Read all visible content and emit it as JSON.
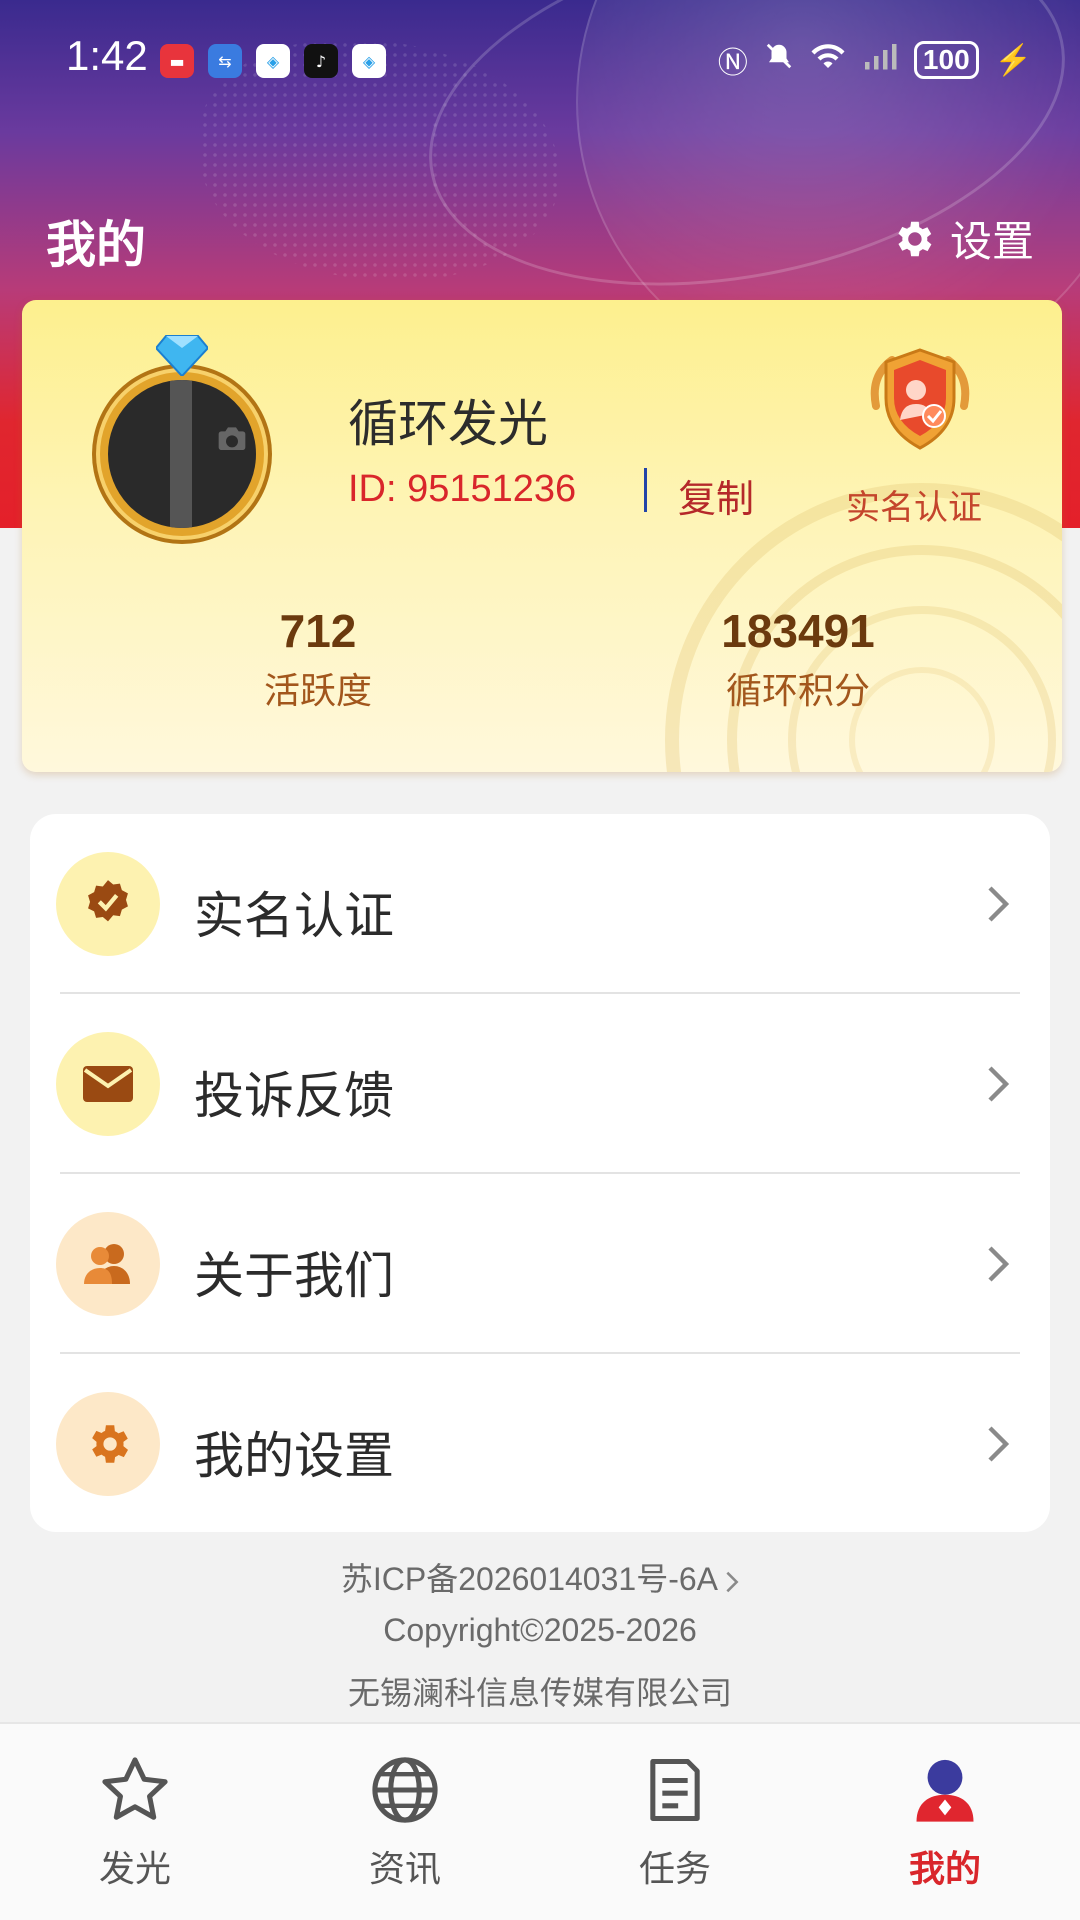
{
  "status_bar": {
    "time": "1:42",
    "apps": [
      "huawei-store-icon",
      "usb-icon",
      "browser-icon",
      "tiktok-icon",
      "browser-icon"
    ],
    "battery": "100"
  },
  "header": {
    "title": "我的",
    "settings_label": "设置"
  },
  "profile": {
    "name": "循环发光",
    "id_text": "ID:  95151236",
    "copy_label": "复制",
    "verify_label": "实名认证",
    "stats": [
      {
        "value": "712",
        "label": "活跃度"
      },
      {
        "value": "183491",
        "label": "循环积分"
      }
    ]
  },
  "menu": {
    "items": [
      {
        "label": "实名认证",
        "icon": "verified-badge-icon"
      },
      {
        "label": "投诉反馈",
        "icon": "envelope-icon"
      },
      {
        "label": "关于我们",
        "icon": "users-icon"
      },
      {
        "label": "我的设置",
        "icon": "gear-icon"
      }
    ]
  },
  "footer": {
    "icp": "苏ICP备2026014031号-6A",
    "copyright": "Copyright©2025-2026",
    "company": "无锡澜科信息传媒有限公司"
  },
  "tabbar": {
    "tabs": [
      {
        "label": "发光",
        "icon": "star-icon"
      },
      {
        "label": "资讯",
        "icon": "globe-icon"
      },
      {
        "label": "任务",
        "icon": "document-icon"
      },
      {
        "label": "我的",
        "icon": "profile-icon",
        "active": true
      }
    ]
  },
  "colors": {
    "accent_red": "#d9262b",
    "card_gold": "#fdf08e",
    "stat_brown": "#6b3a0e"
  }
}
